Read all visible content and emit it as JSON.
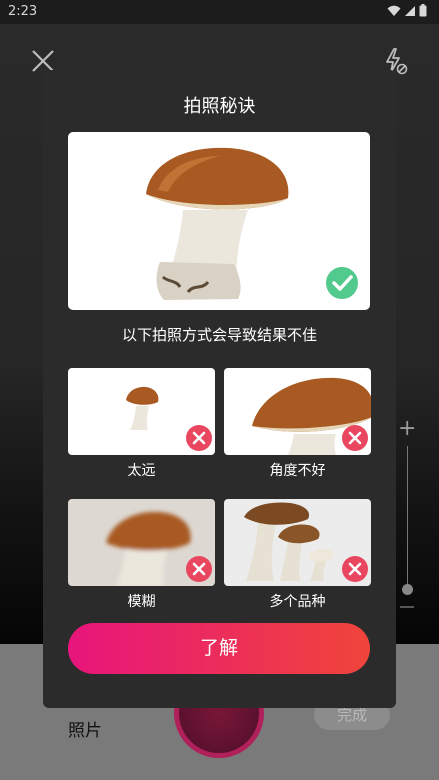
{
  "status_bar": {
    "time": "2:23"
  },
  "camera": {
    "close_icon": "close-icon",
    "flash_icon": "flash-off-icon",
    "zoom_plus": "+",
    "photo_mode_label": "照片",
    "done_label": "完成"
  },
  "dialog": {
    "title": "拍照秘诀",
    "subtitle": "以下拍照方式会导致结果不佳",
    "good_badge": "check-icon",
    "bad_examples": [
      {
        "label": "太远"
      },
      {
        "label": "角度不好"
      },
      {
        "label": "模糊"
      },
      {
        "label": "多个品种"
      }
    ],
    "ok_button": "了解"
  },
  "colors": {
    "accent_start": "#e8157c",
    "accent_end": "#f0453a",
    "good": "#52c98d",
    "bad": "#e8475f"
  }
}
